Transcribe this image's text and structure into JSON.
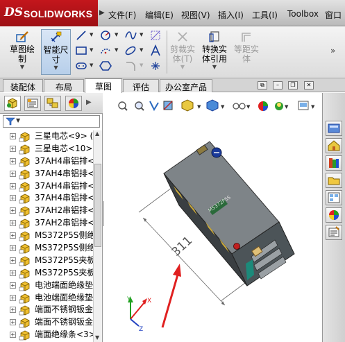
{
  "app": {
    "logo_ds": "DS",
    "logo_text": "SOLIDWORKS",
    "menu": [
      "文件(F)",
      "编辑(E)",
      "视图(V)",
      "插入(I)",
      "工具(I)",
      "Toolbox",
      "窗口"
    ]
  },
  "ribbon": {
    "sketch": "草图绘\n制",
    "smart_dim": "智能尺\n寸",
    "trim": "剪裁实\n体(T)",
    "convert": "转换实\n体引用",
    "offset": "等距实\n体"
  },
  "command_tabs": [
    "装配体",
    "布局",
    "草图",
    "评估",
    "办公室产品"
  ],
  "active_tab": "草图",
  "tree": {
    "items": [
      "三星电芯<9> (",
      "三星电芯<10>",
      "37AH4串铝排<",
      "37AH4串铝排<",
      "37AH4串铝排<",
      "37AH4串铝排<",
      "37AH2串铝排<",
      "37AH2串铝排<",
      "MS372P5S侧绝",
      "MS372P5S侧绝",
      "MS372P5S夹板",
      "MS372P5S夹板",
      "电池端面绝缘垫",
      "电池端面绝缘垫",
      "端面不锈钢钣金",
      "端面不锈钢钣金",
      "端面绝缘条<3>"
    ]
  },
  "model": {
    "dimension": "311",
    "product_label": "MS372P5S"
  },
  "colors": {
    "accent": "#c4161c",
    "arrow": "#e02020",
    "selected": "#b7cfea"
  }
}
